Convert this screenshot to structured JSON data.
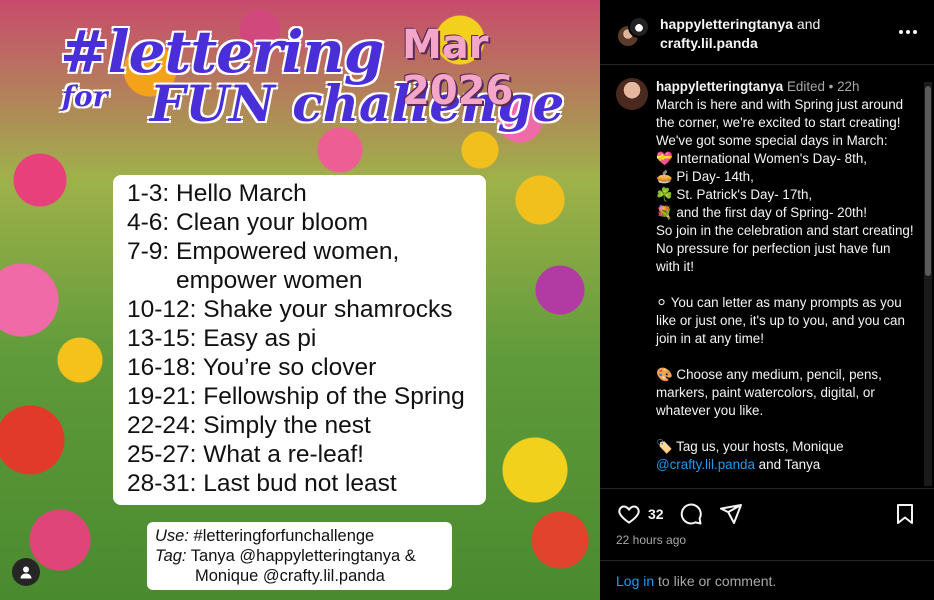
{
  "image": {
    "title_hash": "#lettering",
    "title_for": "for",
    "title_fun": "FUN challenge",
    "date": "Mar 2026",
    "prompts": [
      "1-3: Hello March",
      "4-6: Clean your bloom",
      "7-9: Empowered women,",
      "empower women",
      "10-12: Shake your shamrocks",
      "13-15: Easy as pi",
      "16-18: You’re so clover",
      "19-21: Fellowship of the Spring",
      "22-24: Simply the nest",
      "25-27: What a re-leaf!",
      "28-31: Last bud not least"
    ],
    "use_label": "Use:",
    "use_value": " #letteringforfunchallenge",
    "tag_label": "Tag:",
    "tag_value_1": " Tanya @happyletteringtanya &",
    "tag_value_2": "Monique @crafty.lil.panda"
  },
  "header": {
    "user_a": "happyletteringtanya",
    "and": " and",
    "user_b": "crafty.lil.panda"
  },
  "caption": {
    "username": "happyletteringtanya",
    "edited": " Edited",
    "dot": " • ",
    "time": "22h",
    "paragraphs": [
      "March is here and with Spring just around the corner, we're excited to start creating! We've got some special days in March:",
      "💝 International Women's Day- 8th,",
      "🥧 Pi Day- 14th,",
      "☘️ St. Patrick's Day- 17th,",
      "💐 and the first day of Spring- 20th!",
      "So join in the celebration and start creating! No pressure for perfection just have fun with it!",
      "",
      "⚪ You can letter as many prompts as you like or just one, it's up to you, and you can join in at any time!",
      "",
      "🎨 Choose any medium, pencil, pens, markers, paint watercolors, digital, or whatever you like.",
      ""
    ],
    "tag_line_prefix": "🏷️ Tag us, your hosts, Monique ",
    "tag_line_link": "@crafty.lil.panda",
    "tag_line_suffix": " and Tanya"
  },
  "actions": {
    "like_count": "32",
    "time_ago": "22 hours ago"
  },
  "login": {
    "link": "Log in",
    "text": " to like or comment."
  }
}
